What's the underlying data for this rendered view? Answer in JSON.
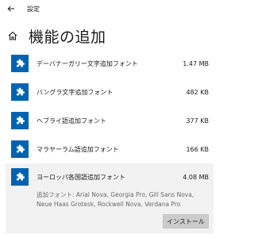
{
  "window": {
    "title": "設定"
  },
  "header": {
    "title": "機能の追加"
  },
  "icons": {
    "back": "back-arrow-icon",
    "home": "home-icon",
    "feature": "puzzle-gear-icon"
  },
  "colors": {
    "accent": "#0063b1",
    "expanded_bg": "#f2f2f2",
    "button_bg": "#cccccc"
  },
  "features": [
    {
      "name": "デーバナーガリー文字追加フォント",
      "size": "1.47 MB"
    },
    {
      "name": "バングラ文字追加フォント",
      "size": "482 KB"
    },
    {
      "name": "ヘブライ語追加フォント",
      "size": "377 KB"
    },
    {
      "name": "マラヤーラム語追加フォント",
      "size": "166 KB"
    },
    {
      "name": "ヨーロッパ各国語追加フォント",
      "size": "4.08 MB",
      "description": "追加フォント: Arial Nova, Georgia Pro, Gill Sans Nova, Neue Haas Grotesk, Rockwell Nova, Verdana Pro",
      "button": "インストール"
    }
  ]
}
